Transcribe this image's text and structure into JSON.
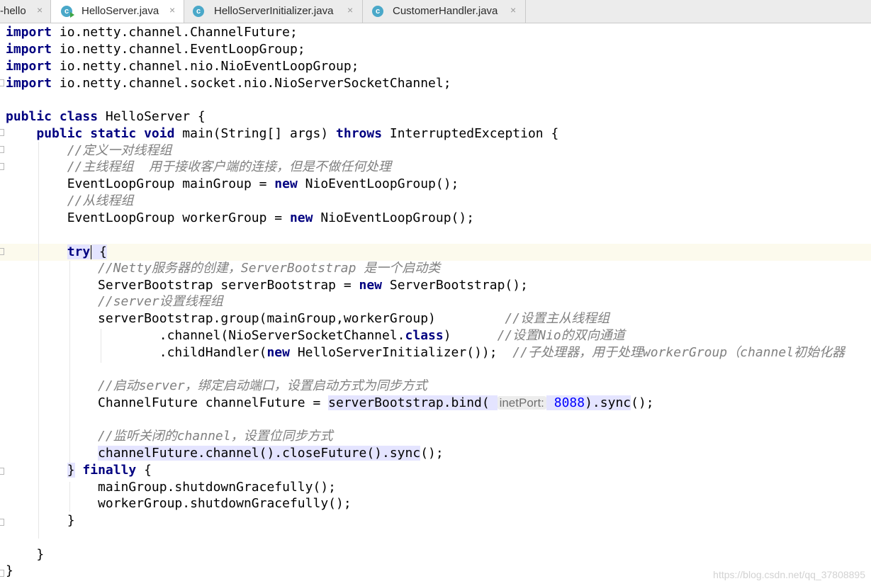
{
  "tabs": [
    {
      "label": "-hello",
      "active": false,
      "icon": "none"
    },
    {
      "label": "HelloServer.java",
      "active": true,
      "icon": "java-class-runnable-icon"
    },
    {
      "label": "HelloServerInitializer.java",
      "active": false,
      "icon": "java-class-icon"
    },
    {
      "label": "CustomerHandler.java",
      "active": false,
      "icon": "java-class-icon"
    }
  ],
  "tab_close_glyph": "×",
  "class_icon_letter": "c",
  "colors": {
    "keyword": "#000080",
    "comment": "#808080",
    "number": "#0000ff",
    "highlight": "#e4e4ff",
    "current_line": "#fcfaed"
  },
  "code": {
    "l1": {
      "kw": "import",
      "rest": " io.netty.channel.ChannelFuture;"
    },
    "l2": {
      "kw": "import",
      "rest": " io.netty.channel.EventLoopGroup;"
    },
    "l3": {
      "kw": "import",
      "rest": " io.netty.channel.nio.NioEventLoopGroup;"
    },
    "l4": {
      "kw": "import",
      "rest": " io.netty.channel.socket.nio.NioServerSocketChannel;"
    },
    "l6": {
      "kw": "public class",
      "rest": " HelloServer {"
    },
    "l7": {
      "indent": "    ",
      "kw1": "public static void",
      "mid": " main(String[] args) ",
      "kw2": "throws",
      "rest": " InterruptedException {"
    },
    "l8": {
      "indent": "        ",
      "comment": "//定义一对线程组"
    },
    "l9": {
      "indent": "        ",
      "comment": "//主线程组  用于接收客户端的连接，但是不做任何处理"
    },
    "l10": {
      "pre": "        EventLoopGroup mainGroup = ",
      "kw": "new",
      "rest": " NioEventLoopGroup();"
    },
    "l11": {
      "indent": "        ",
      "comment": "//从线程组"
    },
    "l12": {
      "pre": "        EventLoopGroup workerGroup = ",
      "kw": "new",
      "rest": " NioEventLoopGroup();"
    },
    "l14": {
      "indent": "        ",
      "kw": "try",
      "rest": " {"
    },
    "l15": {
      "indent": "            ",
      "comment": "//Netty服务器的创建，ServerBootstrap 是一个启动类"
    },
    "l16": {
      "pre": "            ServerBootstrap serverBootstrap = ",
      "kw": "new",
      "rest": " ServerBootstrap();"
    },
    "l17": {
      "indent": "            ",
      "comment": "//server设置线程组"
    },
    "l18": {
      "pre": "            serverBootstrap.group(mainGroup,workerGroup)        ",
      "comment": " //设置主从线程组"
    },
    "l19": {
      "pre": "                    .channel(NioServerSocketChannel.",
      "kw": "class",
      "mid": ")      ",
      "comment": "//设置Nio的双向通道"
    },
    "l20": {
      "pre": "                    .childHandler(",
      "kw": "new",
      "mid": " HelloServerInitializer());  ",
      "comment": "//子处理器，用于处理workerGroup（channel初始化器"
    },
    "l22": {
      "indent": "            ",
      "comment": "//启动server，绑定启动端口，设置启动方式为同步方式"
    },
    "l23": {
      "pre": "            ChannelFuture channelFuture = ",
      "hl": "serverBootstrap.bind(",
      "hint": "inetPort:",
      "num": "8088",
      "hl2": ").sync",
      "rest": "();"
    },
    "l25": {
      "indent": "            ",
      "comment": "//监听关闭的channel，设置位同步方式"
    },
    "l26": {
      "indent": "            ",
      "hl": "channelFuture.channel().closeFuture().sync",
      "rest": "();"
    },
    "l27": {
      "indent": "        ",
      "b1": "}",
      "sp": " ",
      "kw": "finally",
      "rest": " {"
    },
    "l28": {
      "text": "            mainGroup.shutdownGracefully();"
    },
    "l29": {
      "text": "            workerGroup.shutdownGracefully();"
    },
    "l30": {
      "text": "        }"
    },
    "l32": {
      "text": "    }"
    },
    "l33": {
      "text": "}"
    }
  },
  "watermark": "https://blog.csdn.net/qq_37808895"
}
